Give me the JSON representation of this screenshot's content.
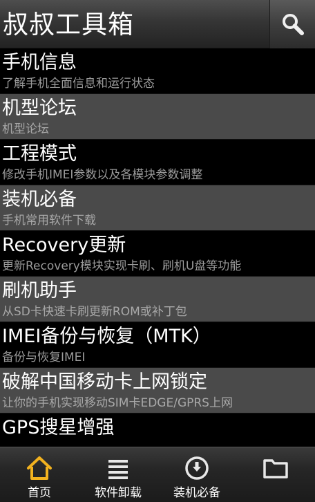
{
  "header": {
    "title": "叔叔工具箱",
    "search_icon": "search-icon"
  },
  "menu": [
    {
      "title": "手机信息",
      "subtitle": "了解手机全面信息和运行状态"
    },
    {
      "title": "机型论坛",
      "subtitle": "机型论坛"
    },
    {
      "title": "工程模式",
      "subtitle": "修改手机IMEI参数以及各模块参数调整"
    },
    {
      "title": "装机必备",
      "subtitle": "手机常用软件下载"
    },
    {
      "title": "Recovery更新",
      "subtitle": "更新Recovery模块实现卡刷、刷机U盘等功能"
    },
    {
      "title": "刷机助手",
      "subtitle": "从SD卡快速卡刷更新ROM或补丁包"
    },
    {
      "title": "IMEI备份与恢复（MTK）",
      "subtitle": "备份与恢复IMEI"
    },
    {
      "title": "破解中国移动卡上网锁定",
      "subtitle": "让你的手机实现移动SIM卡EDGE/GPRS上网"
    },
    {
      "title": "GPS搜星增强",
      "subtitle": ""
    }
  ],
  "nav": [
    {
      "label": "首页",
      "icon": "home-icon",
      "color": "#f2b21f"
    },
    {
      "label": "软件卸载",
      "icon": "list-icon",
      "color": "#e8e8e8"
    },
    {
      "label": "装机必备",
      "icon": "download-icon",
      "color": "#e8e8e8"
    },
    {
      "label": "",
      "icon": "folder-icon",
      "color": "#e8e8e8"
    }
  ],
  "colors": {
    "row_odd": "#000000",
    "row_even": "#4a4a4a",
    "accent": "#f2b21f"
  }
}
